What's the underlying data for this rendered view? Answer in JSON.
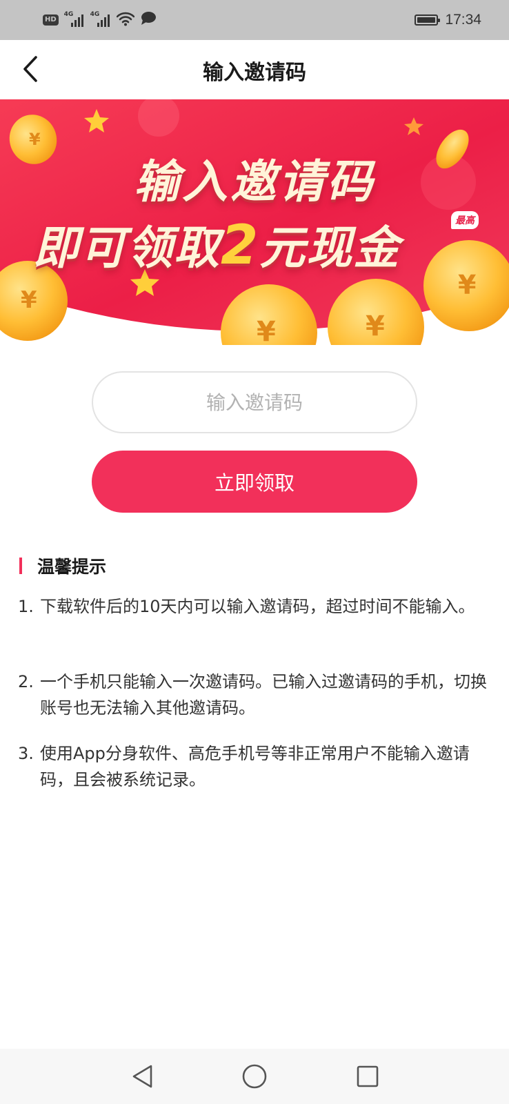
{
  "status_bar": {
    "hd_label": "HD",
    "signal_1": "4G",
    "signal_2": "4G",
    "time": "17:34",
    "icons": [
      "hd-icon",
      "signal-4g-icon",
      "signal-4g-icon",
      "wifi-icon",
      "message-icon",
      "battery-icon"
    ]
  },
  "nav": {
    "title": "输入邀请码",
    "back_icon": "chevron-left-icon"
  },
  "banner": {
    "line1": "输入邀请码",
    "line2_prefix": "即可领取",
    "line2_amount": "2",
    "line2_suffix": "元现金",
    "badge": "最高",
    "colors": {
      "background": "#ef2a4c",
      "coin": "#ffc13a",
      "star": "#ffce3a"
    }
  },
  "form": {
    "input_placeholder": "输入邀请码",
    "input_value": "",
    "submit_label": "立即领取"
  },
  "tips": {
    "title": "温馨提示",
    "items": [
      {
        "num": "1.",
        "text": "下载软件后的10天内可以输入邀请码，超过时间不能输入。"
      },
      {
        "num": "2.",
        "text": "一个手机只能输入一次邀请码。已输入过邀请码的手机，切换账号也无法输入其他邀请码。"
      },
      {
        "num": "3.",
        "text": "使用App分身软件、高危手机号等非正常用户不能输入邀请码，且会被系统记录。"
      }
    ]
  },
  "system_nav": {
    "icons": [
      "back-triangle-icon",
      "home-circle-icon",
      "recents-square-icon"
    ]
  },
  "theme": {
    "accent": "#f2305a",
    "status_bar_bg": "#c4c4c4"
  }
}
